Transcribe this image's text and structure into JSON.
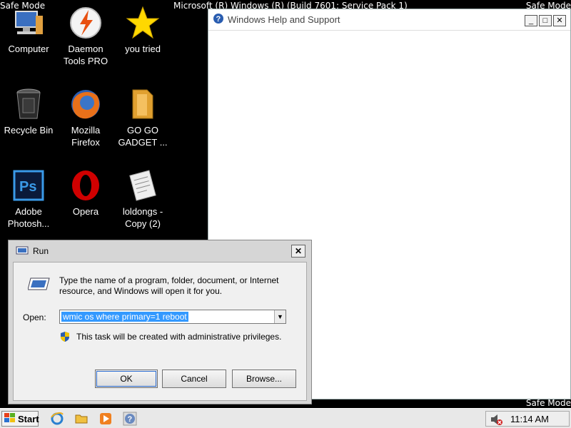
{
  "screen": {
    "safe_mode_label": "Safe Mode",
    "os_banner": "Microsoft (R) Windows (R) (Build 7601: Service Pack 1)"
  },
  "desktop_icons": [
    {
      "label": "Computer",
      "icon": "computer-icon"
    },
    {
      "label": "Daemon Tools PRO",
      "icon": "daemon-tools-icon"
    },
    {
      "label": "you tried",
      "icon": "star-icon"
    },
    {
      "label": "Recycle Bin",
      "icon": "recycle-bin-icon"
    },
    {
      "label": "Mozilla Firefox",
      "icon": "firefox-icon"
    },
    {
      "label": "GO GO GADGET ...",
      "icon": "folder-icon"
    },
    {
      "label": "Adobe Photosh...",
      "icon": "photoshop-icon"
    },
    {
      "label": "Opera",
      "icon": "opera-icon"
    },
    {
      "label": "loldongs - Copy (2)",
      "icon": "document-icon"
    }
  ],
  "help_window": {
    "title": "Windows Help and Support",
    "buttons": {
      "minimize": "_",
      "maximize": "□",
      "close": "✕"
    }
  },
  "run_dialog": {
    "title": "Run",
    "close": "✕",
    "description": "Type the name of a program, folder, document, or Internet resource, and Windows will open it for you.",
    "open_label": "Open:",
    "open_value": "wmic os where primary=1 reboot",
    "admin_note": "This task will be created with administrative privileges.",
    "ok_label": "OK",
    "cancel_label": "Cancel",
    "browse_label": "Browse..."
  },
  "taskbar": {
    "start_label": "Start",
    "quick_launch": [
      "internet-explorer-icon",
      "folder-icon",
      "media-player-icon",
      "help-icon"
    ],
    "clock": "11:14 AM"
  },
  "colors": {
    "desktop": "#000000",
    "selection": "#3399ff",
    "taskbar": "#e8e8e8"
  }
}
